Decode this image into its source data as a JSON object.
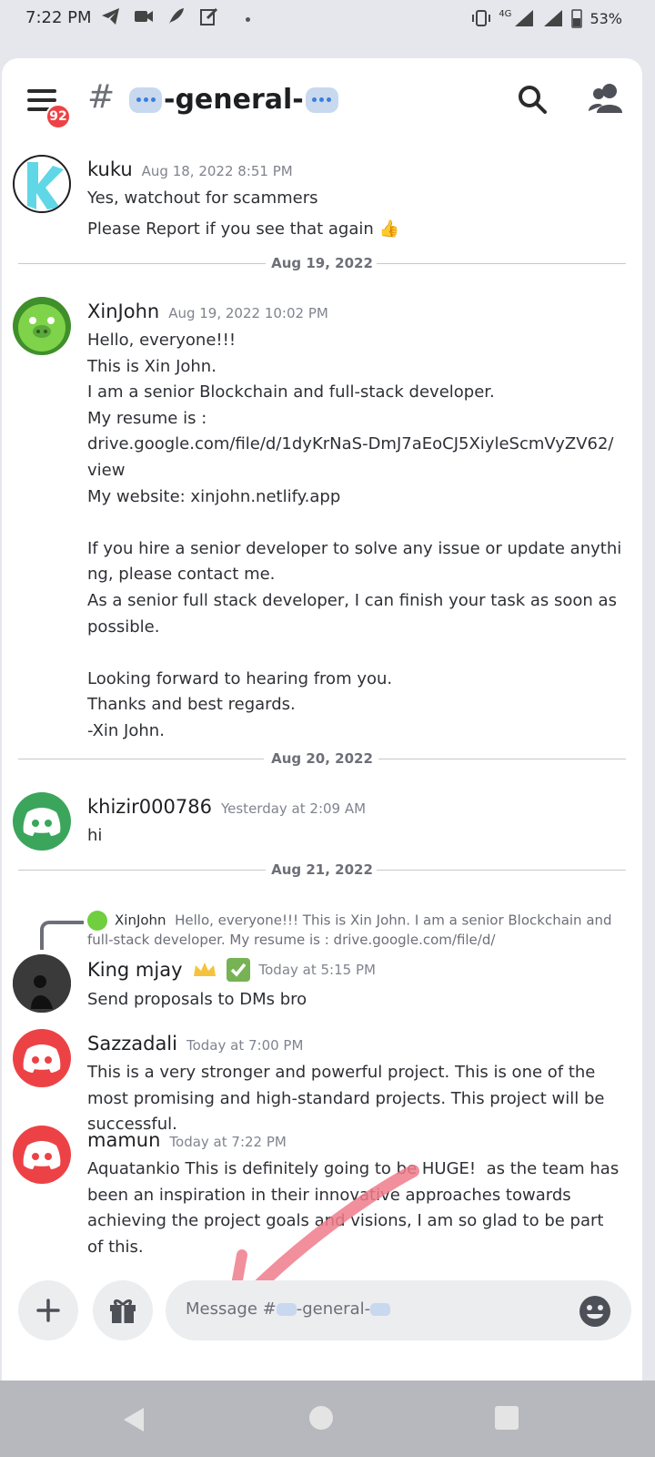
{
  "status_bar": {
    "time": "7:22 PM",
    "network": "4G",
    "battery": "53%"
  },
  "channel": {
    "hash": "#",
    "name": "-general-",
    "unread_badge": "92"
  },
  "messages": [
    {
      "author": "kuku",
      "timestamp": "Aug 18, 2022 8:51 PM",
      "lines": [
        "Yes, watchout for scammers",
        "Please Report if you see that again 👍"
      ]
    },
    {
      "author": "XinJohn",
      "timestamp": "Aug 19, 2022 10:02 PM",
      "text": "Hello, everyone!!!\nThis is Xin John.\nI am a senior Blockchain and full-stack developer.\nMy resume is :\ndrive.google.com/file/d/1dyKrNaS-DmJ7aEoCJ5XiyleScmVyZV62/\nview\nMy website: xinjohn.netlify.app\n\nIf you hire a senior developer to solve any issue or update anything, please contact me.\nAs a senior full stack developer, I can finish your task as soon as possible.\n\nLooking forward to hearing from you.\nThanks and best regards.\n-Xin John."
    },
    {
      "author": "khizir000786",
      "timestamp": "Yesterday at 2:09 AM",
      "text": "hi"
    },
    {
      "author": "King mjay",
      "timestamp": "Today at 5:15 PM",
      "text": "Send proposals to DMs bro",
      "reply": {
        "author": "XinJohn",
        "preview": "Hello, everyone!!! This is Xin John. I am a senior Blockchain and full-stack developer. My resume is : drive.google.com/file/d/"
      }
    },
    {
      "author": "Sazzadali",
      "timestamp": "Today at 7:00 PM",
      "text": "This is a very stronger and powerful project. This is one of the most promising and high-standard projects. This project will be successful."
    },
    {
      "author": "mamun",
      "timestamp": "Today at 7:22 PM",
      "text": "Aquatankio This is definitely going to be HUGE!  as the team has been an inspiration in their innovative approaches towards achieving the project goals and visions, I am so glad to be part of this."
    }
  ],
  "dividers": [
    "Aug 19, 2022",
    "Aug 20, 2022",
    "Aug 21, 2022"
  ],
  "composer": {
    "placeholder_prefix": "Message #",
    "placeholder_suffix": "-general-"
  },
  "icons": [
    "menu-icon",
    "search-icon",
    "members-icon",
    "plus-icon",
    "gift-icon",
    "emoji-icon",
    "crown-emoji",
    "check-emoji",
    "discord-logo"
  ],
  "colors": {
    "discord_green": "#3ba55c",
    "discord_red": "#ed4245",
    "badge_red": "#ed4245",
    "annotation_arrow": "#f07b8b"
  }
}
